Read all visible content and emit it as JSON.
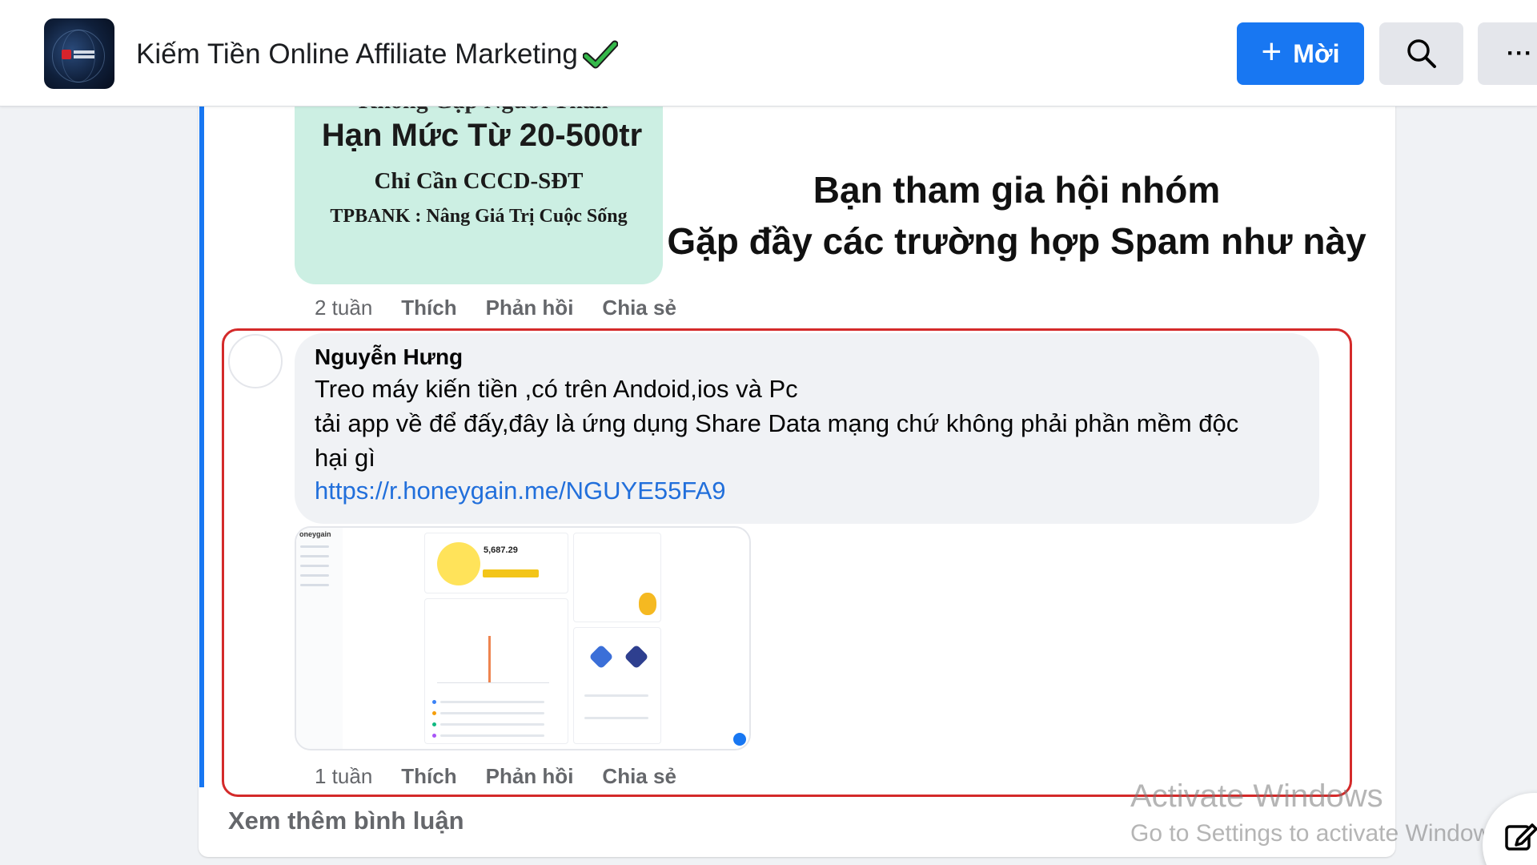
{
  "header": {
    "group_title": "Kiếm Tiền Online Affiliate Marketing",
    "invite_label": "Mời",
    "more_label": "···",
    "icons": {
      "logo": "group-logo",
      "verified": "check-icon",
      "search": "search-icon",
      "plus": "plus-icon"
    }
  },
  "ad_image": {
    "top_cut": "Không Gặp Người Thân",
    "line1": "Hạn Mức Từ 20-500tr",
    "line2": "Chỉ Cần CCCD-SĐT",
    "line3": "TPBANK : Nâng Giá Trị Cuộc Sống"
  },
  "caption": {
    "line1": "Bạn tham gia hội nhóm",
    "line2": "Gặp đầy các trường hợp Spam như này"
  },
  "prev_actions": {
    "time": "2 tuần",
    "like": "Thích",
    "reply": "Phản hồi",
    "share": "Chia sẻ"
  },
  "comment": {
    "author": "Nguyễn Hưng",
    "line1": "Treo máy kiến tiền ,có trên Andoid,ios và Pc",
    "line2": "tải app về để đấy,đây là ứng dụng Share Data mạng chứ không phải phần mềm độc",
    "line3": "hại gì",
    "link": "https://r.honeygain.me/NGUYE55FA9",
    "attachment": {
      "brand": "oneygain",
      "balance": "5,687.29"
    },
    "actions": {
      "time": "1 tuần",
      "like": "Thích",
      "reply": "Phản hồi",
      "share": "Chia sẻ"
    }
  },
  "see_more": "Xem thêm bình luận",
  "watermark": {
    "line1": "Activate Windows",
    "line2": "Go to Settings to activate Windows."
  },
  "colors": {
    "accent": "#1877f2",
    "highlight": "#d42a2a",
    "link": "#216fdb"
  }
}
